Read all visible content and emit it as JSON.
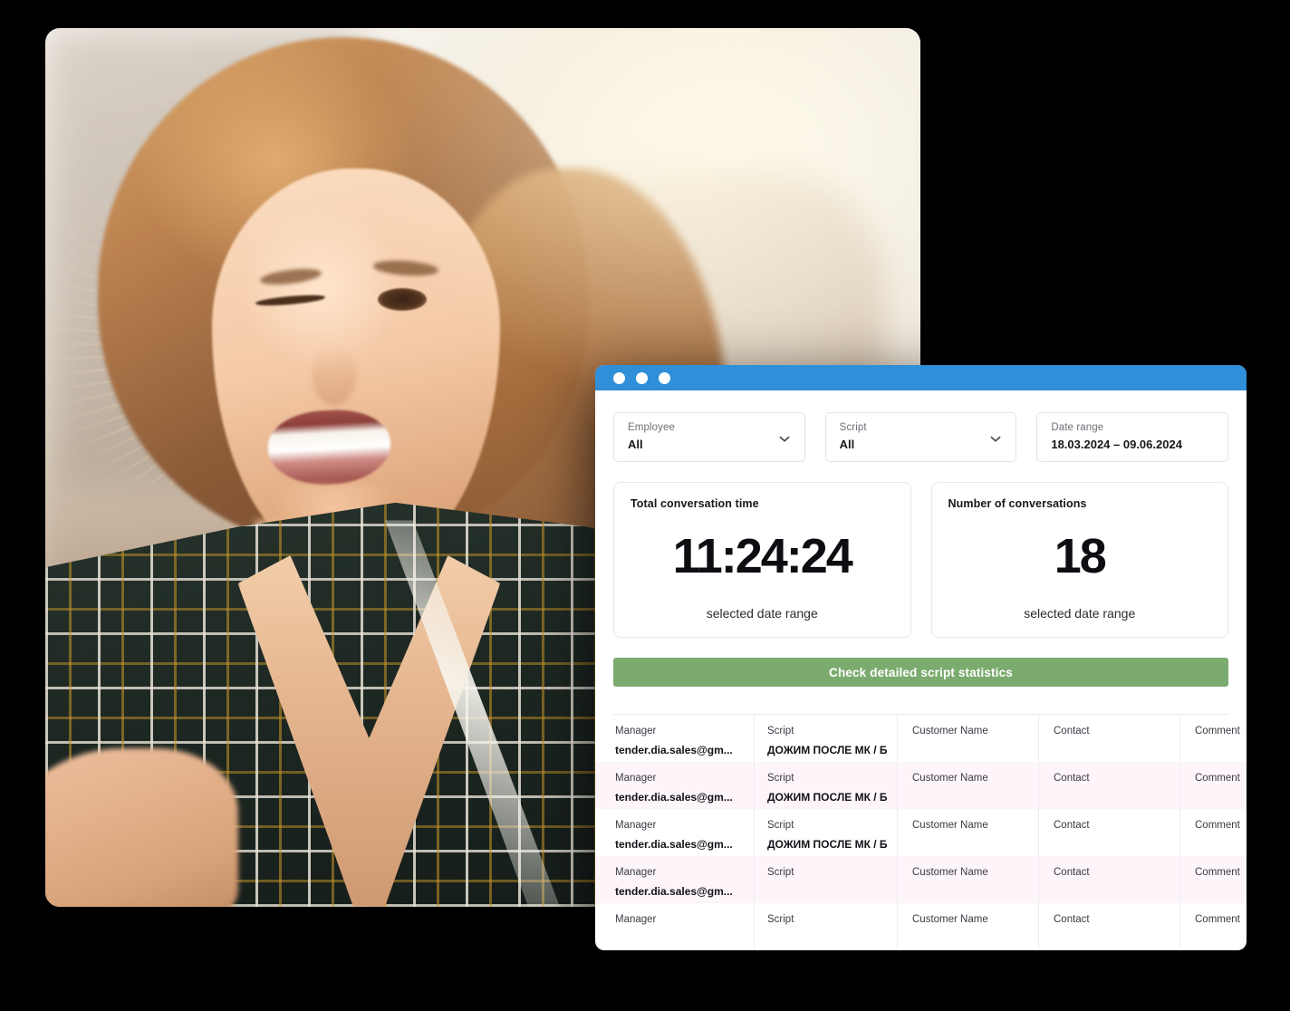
{
  "window": {
    "titlebar_dots": [
      "dot-1",
      "dot-2",
      "dot-3"
    ],
    "accent_blue": "#2f8fd8",
    "accent_green": "#7bab6e",
    "row_highlight": "#fdf5fa"
  },
  "filters": [
    {
      "label": "Employee",
      "value": "All",
      "has_chevron": true,
      "icon": "chevron-down-icon"
    },
    {
      "label": "Script",
      "value": "All",
      "has_chevron": true,
      "icon": "chevron-down-icon"
    },
    {
      "label": "Date range",
      "value": "18.03.2024 – 09.06.2024",
      "has_chevron": false,
      "icon": ""
    }
  ],
  "stats": [
    {
      "title": "Total conversation time",
      "value": "11:24:24",
      "sub": "selected date range"
    },
    {
      "title": "Number of conversations",
      "value": "18",
      "sub": "selected date range"
    }
  ],
  "cta": {
    "label": "Check detailed script statistics"
  },
  "table": {
    "columns": [
      "Manager",
      "Script",
      "Customer Name",
      "Contact",
      "Comment"
    ],
    "rows": [
      {
        "highlight": false,
        "cells": [
          {
            "label": "Manager",
            "value": "tender.dia.sales@gm..."
          },
          {
            "label": "Script",
            "value": "ДОЖИМ ПОСЛЕ МК / Б..."
          },
          {
            "label": "Customer Name",
            "value": ""
          },
          {
            "label": "Contact",
            "value": ""
          },
          {
            "label": "Comment",
            "value": ""
          }
        ]
      },
      {
        "highlight": true,
        "cells": [
          {
            "label": "Manager",
            "value": "tender.dia.sales@gm..."
          },
          {
            "label": "Script",
            "value": "ДОЖИМ ПОСЛЕ МК / Б..."
          },
          {
            "label": "Customer Name",
            "value": ""
          },
          {
            "label": "Contact",
            "value": ""
          },
          {
            "label": "Comment",
            "value": ""
          }
        ]
      },
      {
        "highlight": false,
        "cells": [
          {
            "label": "Manager",
            "value": "tender.dia.sales@gm..."
          },
          {
            "label": "Script",
            "value": "ДОЖИМ ПОСЛЕ МК / Б..."
          },
          {
            "label": "Customer Name",
            "value": ""
          },
          {
            "label": "Contact",
            "value": ""
          },
          {
            "label": "Comment",
            "value": ""
          }
        ]
      },
      {
        "highlight": true,
        "cells": [
          {
            "label": "Manager",
            "value": "tender.dia.sales@gm..."
          },
          {
            "label": "Script",
            "value": ""
          },
          {
            "label": "Customer Name",
            "value": ""
          },
          {
            "label": "Contact",
            "value": ""
          },
          {
            "label": "Comment",
            "value": ""
          }
        ]
      },
      {
        "highlight": false,
        "cells": [
          {
            "label": "Manager",
            "value": ""
          },
          {
            "label": "Script",
            "value": ""
          },
          {
            "label": "Customer Name",
            "value": ""
          },
          {
            "label": "Contact",
            "value": ""
          },
          {
            "label": "Comment",
            "value": ""
          }
        ]
      }
    ]
  },
  "photo": {
    "alt": "Smiling young woman winking outdoors at sunset wearing a plaid shirt"
  }
}
